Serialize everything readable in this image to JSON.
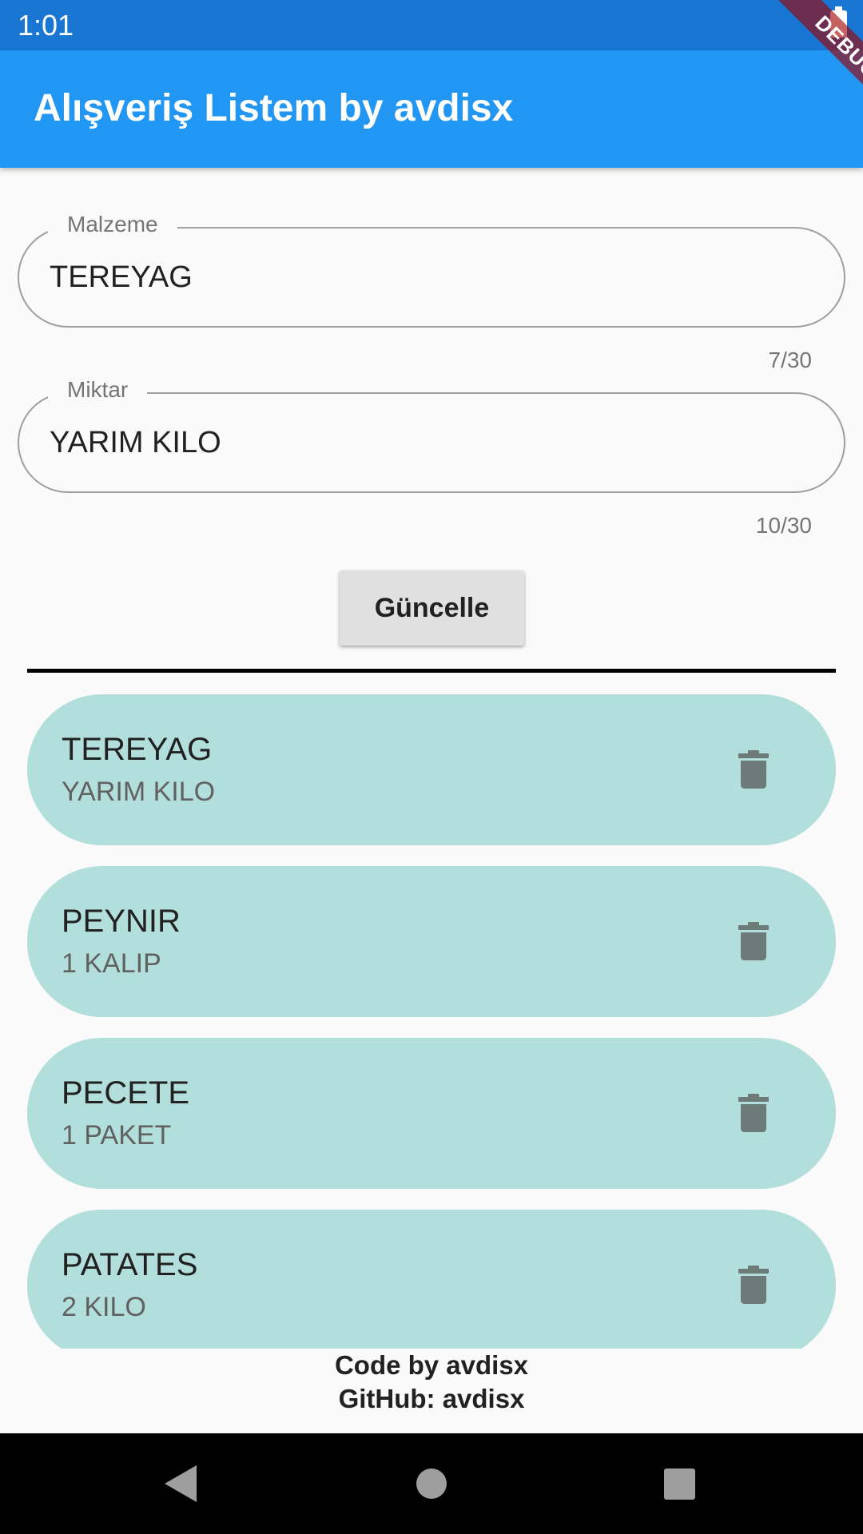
{
  "status_bar": {
    "time": "1:01",
    "battery_icon": "battery-full-icon"
  },
  "debug_banner": {
    "label": "DEBUG"
  },
  "app_bar": {
    "title": "Alışveriş Listem by avdisx",
    "color": "#2196f3"
  },
  "form": {
    "ingredient": {
      "label": "Malzeme",
      "value": "TEREYAG",
      "counter": "7/30"
    },
    "amount": {
      "label": "Miktar",
      "value": "YARIM KILO",
      "counter": "10/30"
    },
    "update_button_label": "Güncelle"
  },
  "list": {
    "item_color": "#b2dfdb",
    "delete_icon": "trash-icon",
    "items": [
      {
        "name": "TEREYAG",
        "quantity": "YARIM KILO"
      },
      {
        "name": "PEYNIR",
        "quantity": "1 KALIP"
      },
      {
        "name": "PECETE",
        "quantity": "1 PAKET"
      },
      {
        "name": "PATATES",
        "quantity": "2 KILO"
      }
    ]
  },
  "footer": {
    "line1": "Code by avdisx",
    "line2": "GitHub: avdisx"
  },
  "nav_bar": {
    "back_icon": "back-triangle-icon",
    "home_icon": "home-circle-icon",
    "recents_icon": "recents-square-icon"
  }
}
